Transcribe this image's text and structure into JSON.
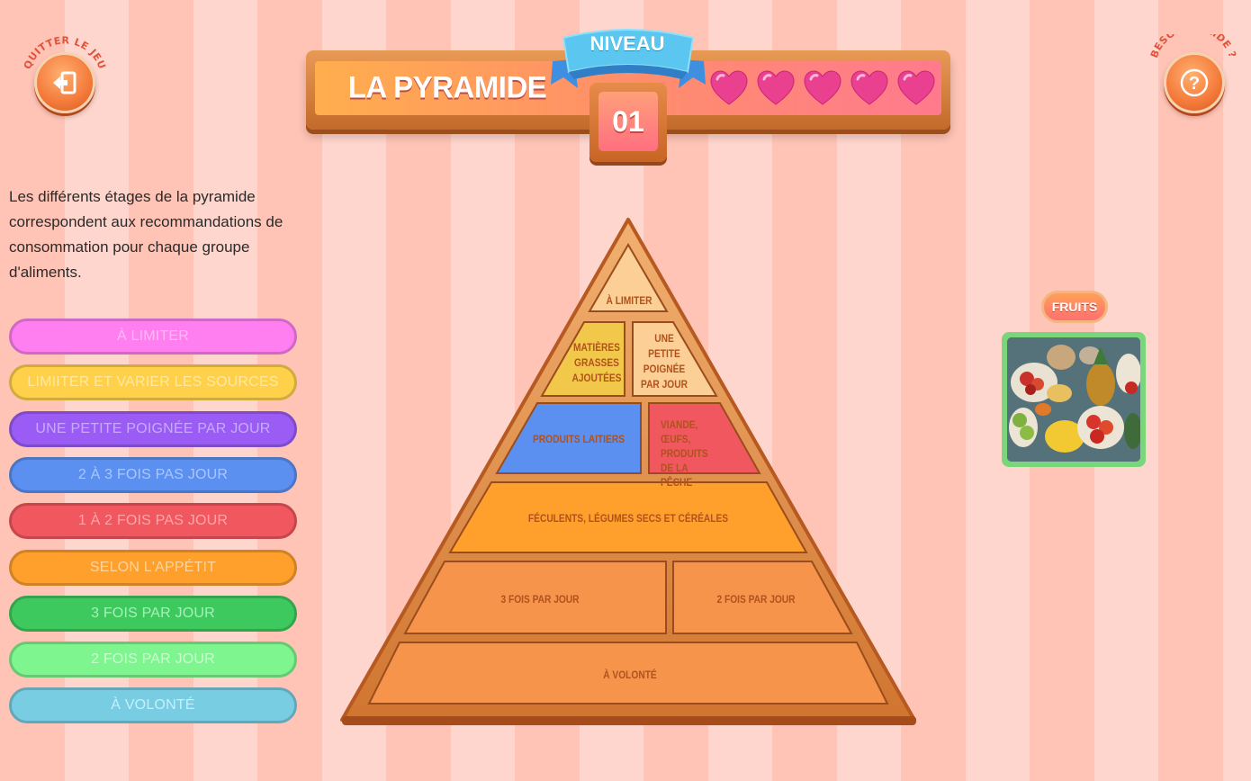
{
  "header": {
    "quit_label": "QUITTER LE JEU",
    "help_label": "BESOIN D'AIDE ?",
    "title": "LA PYRAMIDE",
    "level_label": "NIVEAU",
    "level_number": "01",
    "lives": 5
  },
  "intro_text": "Les différents étages de la pyramide correspondent aux recommandations de consommation pour chaque groupe d'aliments.",
  "categories": [
    {
      "label": "À LIMITER",
      "color": "#ff7ff0",
      "text_color": "#ffb8f6"
    },
    {
      "label": "LIMIITER ET VARIER LES SOURCES",
      "color": "#ffd04a",
      "text_color": "#ffe9a0"
    },
    {
      "label": "UNE PETITE POIGNÉE PAR JOUR",
      "color": "#9a5cf5",
      "text_color": "#c9a9ff"
    },
    {
      "label": "2 À 3 FOIS PAS JOUR",
      "color": "#5b8ff0",
      "text_color": "#a9c7ff"
    },
    {
      "label": "1 À 2 FOIS PAS JOUR",
      "color": "#f0575f",
      "text_color": "#ffa4a8"
    },
    {
      "label": "SELON L'APPÉTIT",
      "color": "#ff9f2c",
      "text_color": "#ffd59e"
    },
    {
      "label": "3 FOIS PAR JOUR",
      "color": "#3ec95e",
      "text_color": "#a6f1b8"
    },
    {
      "label": "2 FOIS PAR JOUR",
      "color": "#7ef58e",
      "text_color": "#c8ffcf"
    },
    {
      "label": "À VOLONTÉ",
      "color": "#79cde3",
      "text_color": "#c4f0fb"
    }
  ],
  "pyramid": {
    "top": "À LIMITER",
    "fats": "MATIÈRES GRASSES AJOUTÉES",
    "nuts": "UNE PETITE POIGNÉE PAR JOUR",
    "dairy": "PRODUITS LAITIERS",
    "meat": "VIANDE, ŒUFS, PRODUITS DE LA PÊCHE",
    "starch": "FÉCULENTS, LÉGUMES SECS ET CÉRÉALES",
    "veg": "3 FOIS PAR JOUR",
    "fruit": "2 FOIS PAR JOUR",
    "water": "À VOLONTÉ"
  },
  "current_food": {
    "label": "FRUITS"
  }
}
